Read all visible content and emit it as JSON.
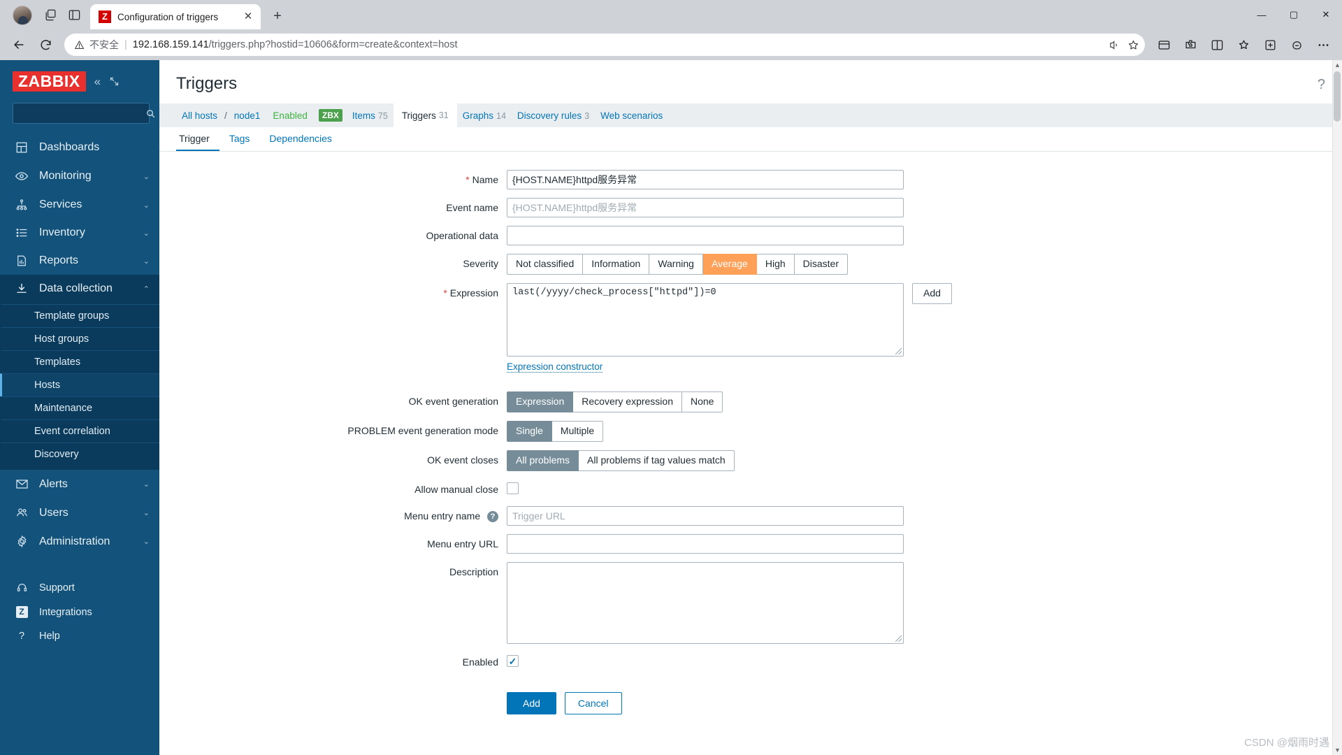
{
  "browser": {
    "tab": {
      "title": "Configuration of triggers",
      "favicon_letter": "Z"
    },
    "new_tab_label": "+",
    "security_label": "不安全",
    "url_host": "192.168.159.141",
    "url_path": "/triggers.php?hostid=10606&form=create&context=host",
    "window_buttons": {
      "minimize": "—",
      "maximize": "▢",
      "close": "✕"
    }
  },
  "sidebar": {
    "logo": "ZABBIX",
    "search_placeholder": "",
    "items": [
      {
        "label": "Dashboards",
        "icon": "dashboard-icon",
        "chevron": ""
      },
      {
        "label": "Monitoring",
        "icon": "eye-icon",
        "chevron": "⌄"
      },
      {
        "label": "Services",
        "icon": "sitemap-icon",
        "chevron": "⌄"
      },
      {
        "label": "Inventory",
        "icon": "list-icon",
        "chevron": "⌄"
      },
      {
        "label": "Reports",
        "icon": "bar-chart-icon",
        "chevron": "⌄"
      },
      {
        "label": "Data collection",
        "icon": "download-icon",
        "chevron": "⌃"
      }
    ],
    "submenu": [
      {
        "label": "Template groups"
      },
      {
        "label": "Host groups"
      },
      {
        "label": "Templates"
      },
      {
        "label": "Hosts"
      },
      {
        "label": "Maintenance"
      },
      {
        "label": "Event correlation"
      },
      {
        "label": "Discovery"
      }
    ],
    "items_bottom": [
      {
        "label": "Alerts",
        "icon": "envelope-icon",
        "chevron": "⌄"
      },
      {
        "label": "Users",
        "icon": "users-icon",
        "chevron": "⌄"
      },
      {
        "label": "Administration",
        "icon": "gear-icon",
        "chevron": "⌄"
      }
    ],
    "items_footer": [
      {
        "label": "Support",
        "icon": "headset-icon"
      },
      {
        "label": "Integrations",
        "icon": "zabbix-z-icon"
      },
      {
        "label": "Help",
        "icon": "question-icon"
      }
    ]
  },
  "header": {
    "title": "Triggers",
    "help_icon": "?"
  },
  "breadcrumb": {
    "all_hosts": "All hosts",
    "separator": "/",
    "host": "node1",
    "status": "Enabled",
    "agent_badge": "ZBX",
    "tabs": [
      {
        "label": "Items",
        "count": "75",
        "current": false
      },
      {
        "label": "Triggers",
        "count": "31",
        "current": true
      },
      {
        "label": "Graphs",
        "count": "14",
        "current": false
      },
      {
        "label": "Discovery rules",
        "count": "3",
        "current": false
      },
      {
        "label": "Web scenarios",
        "count": "",
        "current": false
      }
    ]
  },
  "form_tabs": [
    {
      "label": "Trigger",
      "active": true
    },
    {
      "label": "Tags",
      "active": false
    },
    {
      "label": "Dependencies",
      "active": false
    }
  ],
  "form": {
    "name_label": "Name",
    "name_value": "{HOST.NAME}httpd服务异常",
    "event_name_label": "Event name",
    "event_name_placeholder": "{HOST.NAME}httpd服务异常",
    "operational_data_label": "Operational data",
    "operational_data_value": "",
    "severity_label": "Severity",
    "severity_options": [
      {
        "label": "Not classified",
        "selected": false
      },
      {
        "label": "Information",
        "selected": false
      },
      {
        "label": "Warning",
        "selected": false
      },
      {
        "label": "Average",
        "selected": true
      },
      {
        "label": "High",
        "selected": false
      },
      {
        "label": "Disaster",
        "selected": false
      }
    ],
    "severity_selected_color": "#ffa059",
    "expression_label": "Expression",
    "expression_value": "last(/yyyy/check_process[\"httpd\"])=0",
    "expression_add_button": "Add",
    "expression_constructor_link": "Expression constructor",
    "ok_event_generation_label": "OK event generation",
    "ok_event_generation_options": [
      {
        "label": "Expression",
        "selected": true
      },
      {
        "label": "Recovery expression",
        "selected": false
      },
      {
        "label": "None",
        "selected": false
      }
    ],
    "problem_event_mode_label": "PROBLEM event generation mode",
    "problem_event_mode_options": [
      {
        "label": "Single",
        "selected": true
      },
      {
        "label": "Multiple",
        "selected": false
      }
    ],
    "ok_event_closes_label": "OK event closes",
    "ok_event_closes_options": [
      {
        "label": "All problems",
        "selected": true
      },
      {
        "label": "All problems if tag values match",
        "selected": false
      }
    ],
    "allow_manual_close_label": "Allow manual close",
    "allow_manual_close_checked": false,
    "menu_entry_name_label": "Menu entry name",
    "menu_entry_name_help": "?",
    "menu_entry_name_placeholder": "Trigger URL",
    "menu_entry_name_value": "",
    "menu_entry_url_label": "Menu entry URL",
    "menu_entry_url_value": "",
    "description_label": "Description",
    "description_value": "",
    "enabled_label": "Enabled",
    "enabled_checked": true,
    "enabled_tick": "✓",
    "submit_label": "Add",
    "cancel_label": "Cancel",
    "required_marker": "*"
  },
  "watermark": "CSDN @烟雨时遇",
  "colors": {
    "accent": "#0275b8",
    "sidebar": "#13527a",
    "severity_average": "#ffa059",
    "zbx_green": "#4ca14c",
    "segment_selected": "#768d99"
  }
}
